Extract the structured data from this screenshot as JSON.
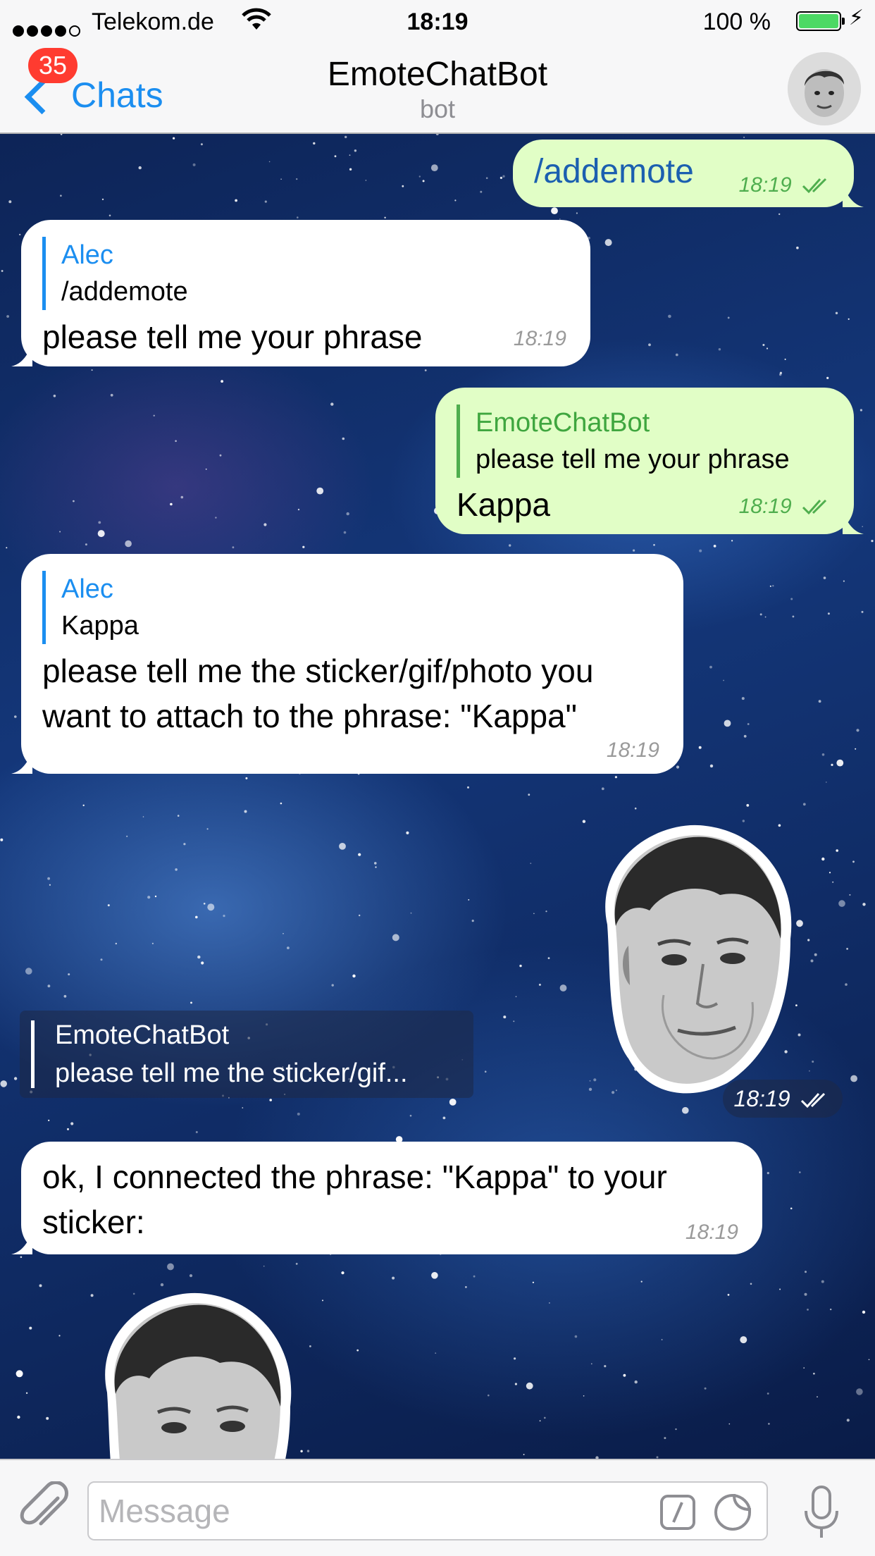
{
  "status_bar": {
    "carrier": "Telekom.de",
    "time": "18:19",
    "battery": "100 %",
    "battery_color": "#4cd964",
    "signal_icon": "signal-dots-icon",
    "wifi_icon": "wifi-icon",
    "charging_icon": "bolt-icon"
  },
  "nav": {
    "back_label": "Chats",
    "unread_count": "35",
    "title": "EmoteChatBot",
    "subtitle": "bot",
    "accent_color": "#1b8ef0",
    "badge_color": "#ff3b30"
  },
  "messages": [
    {
      "id": "m1",
      "direction": "out",
      "text": "/addemote",
      "time": "18:19",
      "status": "read"
    },
    {
      "id": "m2",
      "direction": "in",
      "reply_name": "Alec",
      "reply_text": "/addemote",
      "text": "please tell me your phrase",
      "time": "18:19"
    },
    {
      "id": "m3",
      "direction": "out",
      "reply_name": "EmoteChatBot",
      "reply_text": "please tell me your phrase",
      "text": "Kappa",
      "time": "18:19",
      "status": "read"
    },
    {
      "id": "m4",
      "direction": "in",
      "reply_name": "Alec",
      "reply_text": "Kappa",
      "text_line1": "please tell me the sticker/gif/photo you",
      "text_line2": "want to attach to the phrase: \"Kappa\"",
      "time": "18:19"
    },
    {
      "id": "m5",
      "direction": "out",
      "type": "sticker",
      "sticker_icon": "kappa-face-sticker",
      "reply_name": "EmoteChatBot",
      "reply_text": "please tell me the sticker/gif...",
      "time": "18:19",
      "status": "read"
    },
    {
      "id": "m6",
      "direction": "in",
      "text_line1": "ok, I connected the phrase: \"Kappa\" to your",
      "text_line2": "sticker:",
      "time": "18:19"
    },
    {
      "id": "m7",
      "direction": "in",
      "type": "sticker",
      "sticker_icon": "kappa-face-sticker"
    }
  ],
  "colors": {
    "incoming_bubble": "#ffffff",
    "outgoing_bubble": "#e1fec6",
    "outgoing_accent": "#4fae4e",
    "incoming_accent": "#1b8ef0"
  },
  "input": {
    "placeholder": "Message",
    "attach_icon": "paperclip-icon",
    "commands_icon": "slash-command-icon",
    "stickers_icon": "sticker-icon",
    "mic_icon": "microphone-icon"
  }
}
